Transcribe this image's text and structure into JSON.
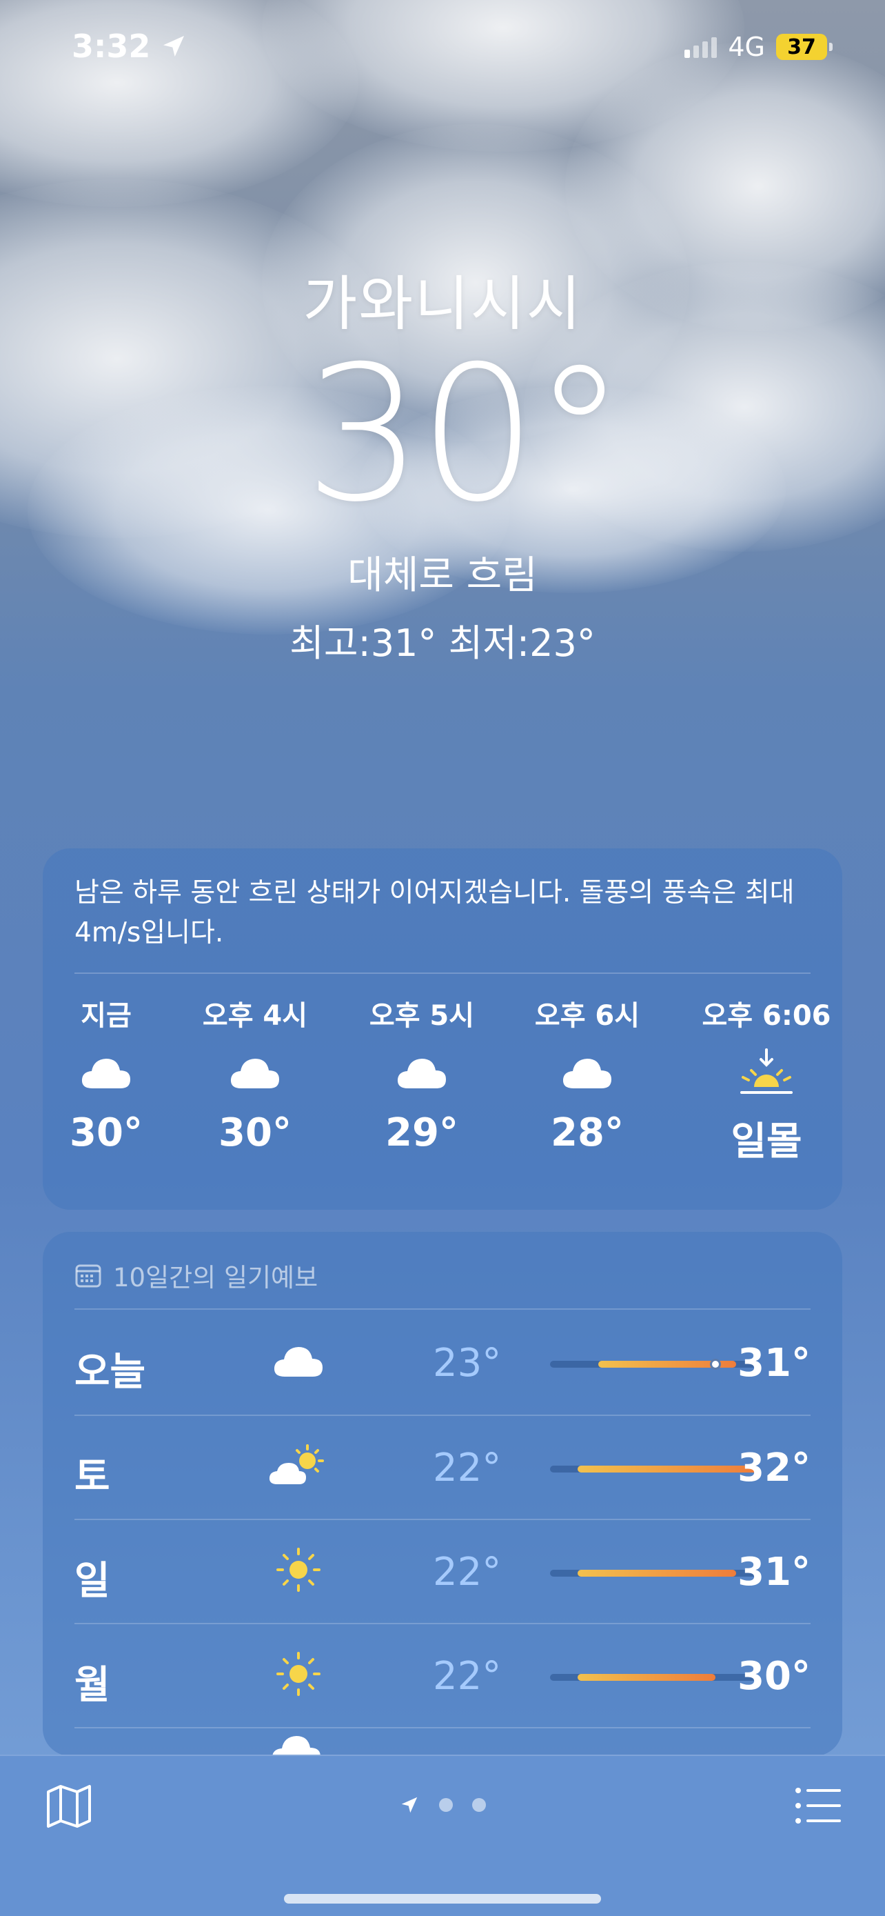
{
  "status_bar": {
    "time": "3:32",
    "location_icon": "location-arrow-icon",
    "network": "4G",
    "battery": "37"
  },
  "current": {
    "city": "가와니시시",
    "temperature": "30°",
    "condition": "대체로 흐림",
    "high_low": "최고:31°  최저:23°"
  },
  "hourly": {
    "summary": "남은 하루 동안 흐린 상태가 이어지겠습니다. 돌풍의 풍속은 최대 4m/s입니다.",
    "items": [
      {
        "label": "지금",
        "icon": "cloud-icon",
        "value": "30°"
      },
      {
        "label": "오후 4시",
        "icon": "cloud-icon",
        "value": "30°"
      },
      {
        "label": "오후 5시",
        "icon": "cloud-icon",
        "value": "29°"
      },
      {
        "label": "오후 6시",
        "icon": "cloud-icon",
        "value": "28°"
      },
      {
        "label": "오후 6:06",
        "icon": "sunset-icon",
        "value": "일몰"
      }
    ]
  },
  "daily": {
    "header": "10일간의 일기예보",
    "header_icon": "calendar-icon",
    "range": [
      22,
      32
    ],
    "days": [
      {
        "day": "오늘",
        "icon": "cloud-icon",
        "low": "23°",
        "high": "31°",
        "low_value": 23,
        "high_value": 31,
        "current_value": 30
      },
      {
        "day": "토",
        "icon": "partly-cloudy-icon",
        "low": "22°",
        "high": "32°",
        "low_value": 22,
        "high_value": 32
      },
      {
        "day": "일",
        "icon": "sun-icon",
        "low": "22°",
        "high": "31°",
        "low_value": 22,
        "high_value": 31
      },
      {
        "day": "월",
        "icon": "sun-icon",
        "low": "22°",
        "high": "30°",
        "low_value": 22,
        "high_value": 30
      }
    ]
  },
  "bottom_bar": {
    "map_icon": "map-icon",
    "list_icon": "list-icon",
    "pages": [
      "location-arrow-icon",
      "page-dot",
      "page-dot"
    ]
  },
  "colors": {
    "bar_cool": "#f2c14e",
    "bar_warm": "#ee7d3b",
    "battery": "#f4d230"
  }
}
